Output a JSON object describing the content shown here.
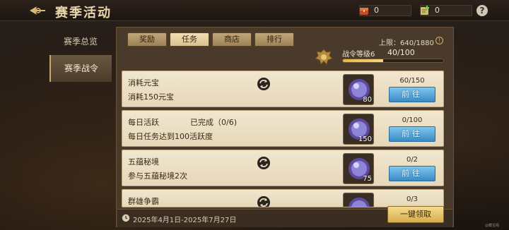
{
  "header": {
    "title": "赛季活动",
    "currency_1": "0",
    "currency_2": "0",
    "help": "?"
  },
  "sidebar": {
    "items": [
      {
        "label": "赛季总览"
      },
      {
        "label": "赛季战令"
      }
    ]
  },
  "tabs": [
    {
      "label": "奖励"
    },
    {
      "label": "任务"
    },
    {
      "label": "商店"
    },
    {
      "label": "排行"
    }
  ],
  "pass": {
    "limit": "上限：640/1880",
    "level_label": "战令等级6",
    "level_progress": "40/100",
    "progress_fraction": 0.4
  },
  "tasks": [
    {
      "name": "消耗元宝",
      "status": "",
      "desc": "消耗150元宝",
      "reward_count": "80",
      "progress": "60/150",
      "button": "前往",
      "has_refresh": true
    },
    {
      "name": "每日活跃",
      "status": "已完成（0/6)",
      "desc": "每日任务达到100活跃度",
      "reward_count": "150",
      "progress": "0/100",
      "button": "前往",
      "has_refresh": false
    },
    {
      "name": "五蕴秘境",
      "status": "",
      "desc": "参与五蕴秘境2次",
      "reward_count": "75",
      "progress": "0/2",
      "button": "前往",
      "has_refresh": true
    },
    {
      "name": "群雄争霸",
      "status": "",
      "desc": "",
      "reward_count": "",
      "progress": "0/3",
      "button": "",
      "has_refresh": true
    }
  ],
  "footer": {
    "date_range": "2025年4月1日-2025年7月27日",
    "claim_all": "一键领取"
  },
  "watermark": "@藏宝阁"
}
